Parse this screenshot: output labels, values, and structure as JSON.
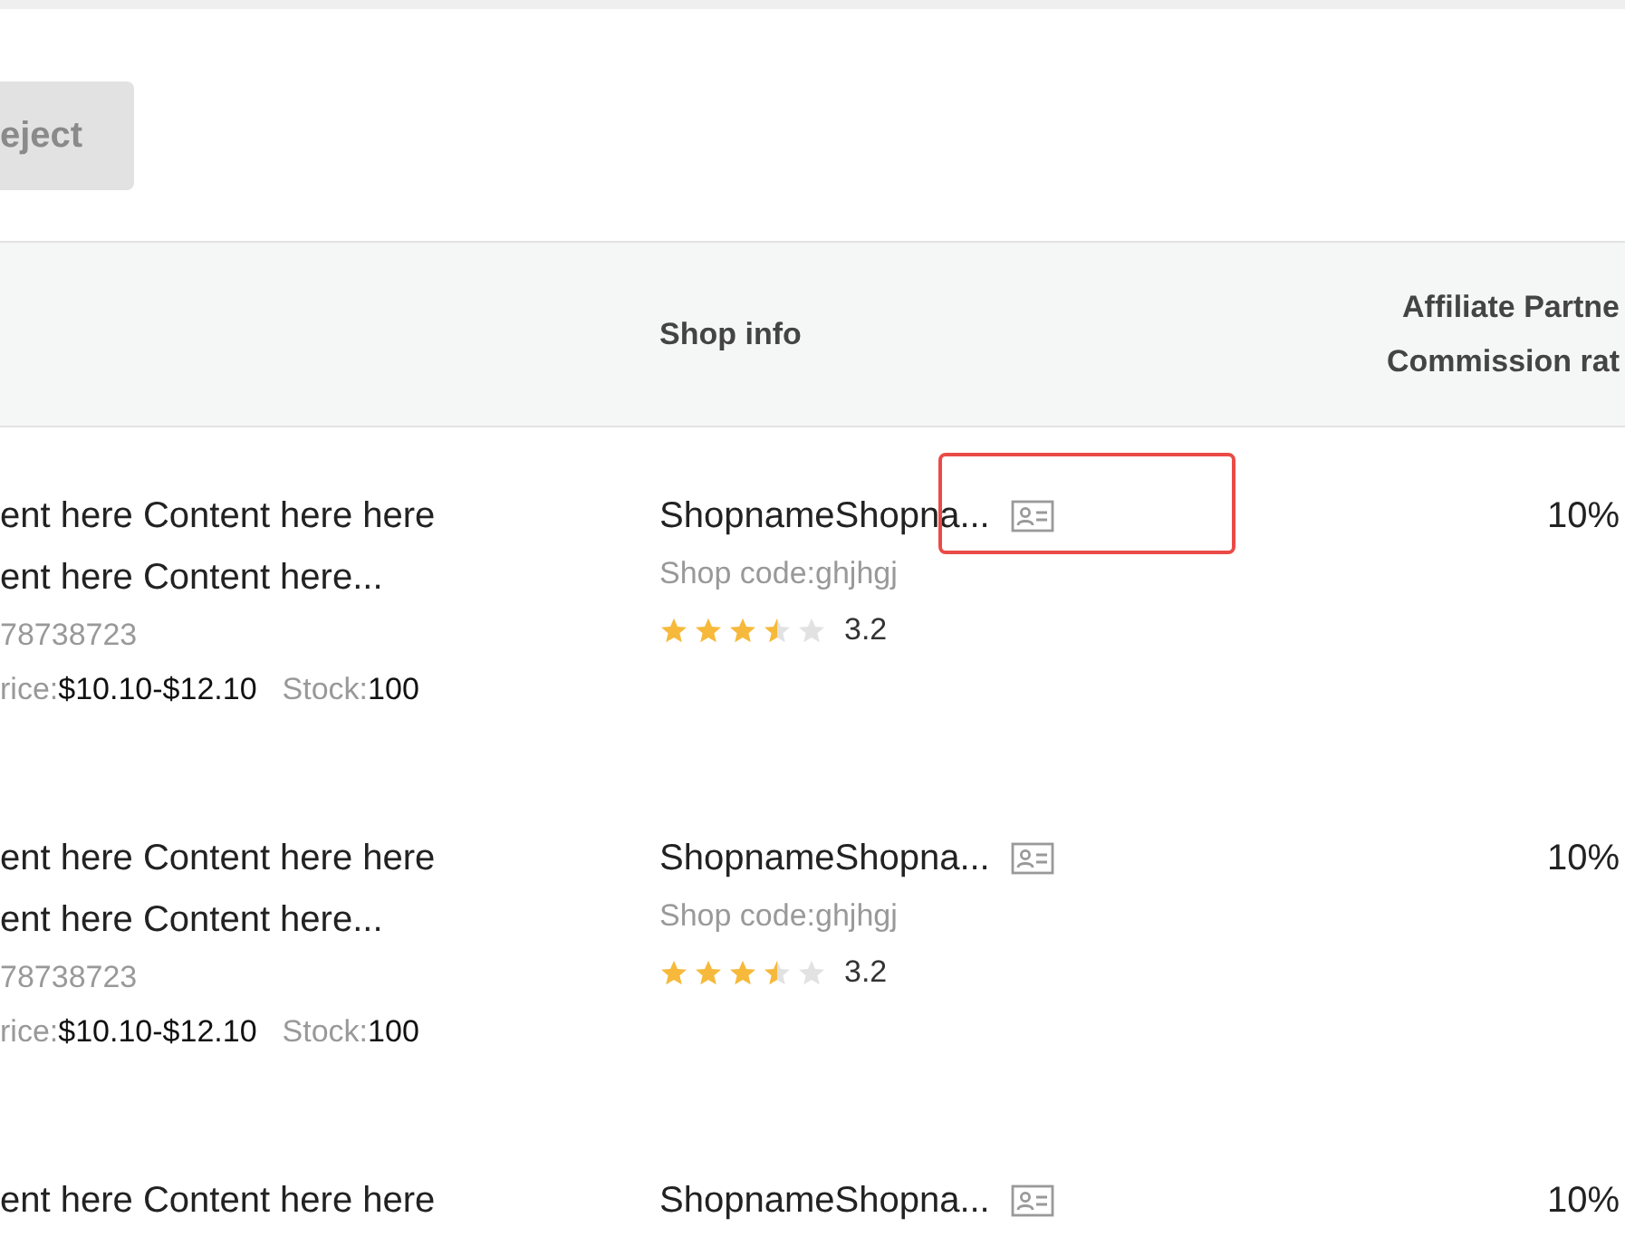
{
  "toolbar": {
    "reject_button": {
      "label": "eject",
      "disabled": true
    }
  },
  "table": {
    "columns": [
      {
        "label": "Shop info"
      },
      {
        "label_lines": [
          "Affiliate Partne",
          "Commission rat"
        ]
      }
    ],
    "rows": [
      {
        "title_lines": [
          "ent here Content here here",
          "ent here Content here..."
        ],
        "id": "78738723",
        "price_label": "rice:",
        "price": "$10.10-$12.10",
        "stock_label": "Stock:",
        "stock": "100",
        "shop_name": "ShopnameShopna...",
        "shop_code": "Shop code:ghjhgj",
        "stars": 3.5,
        "rating": "3.2",
        "commission": "10%",
        "highlighted": true
      },
      {
        "title_lines": [
          "ent here Content here here",
          "ent here Content here..."
        ],
        "id": "78738723",
        "price_label": "rice:",
        "price": "$10.10-$12.10",
        "stock_label": "Stock:",
        "stock": "100",
        "shop_name": "ShopnameShopna...",
        "shop_code": "Shop code:ghjhgj",
        "stars": 3.5,
        "rating": "3.2",
        "commission": "10%",
        "highlighted": false
      },
      {
        "title_lines": [
          "ent here Content here here"
        ],
        "shop_name": "ShopnameShopna...",
        "commission": "10%",
        "highlighted": false
      }
    ]
  }
}
